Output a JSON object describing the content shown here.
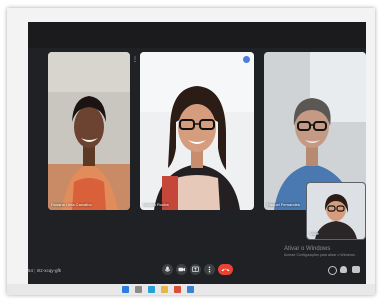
{
  "participants": [
    {
      "name": "Rosana Lima Carvalho"
    },
    {
      "name": "Sandra Rocha"
    },
    {
      "name": "Raquel Fernandes"
    }
  ],
  "self_view": {
    "name": "Você"
  },
  "meeting": {
    "code": "ntz-xcqy-gfk",
    "time": "54"
  },
  "controls": {
    "mic": "mic-icon",
    "camera": "camera-icon",
    "present": "present-icon",
    "more": "more-icon",
    "end": "end-call-icon"
  },
  "windows_watermark": {
    "title": "Ativar o Windows",
    "subtitle": "Acesse Configurações para ativar o Windows."
  },
  "tile_menu_glyph": "⋮",
  "colors": {
    "meet_background": "#202124",
    "end_call": "#ea4335",
    "pin_badge": "#4a7de0"
  }
}
